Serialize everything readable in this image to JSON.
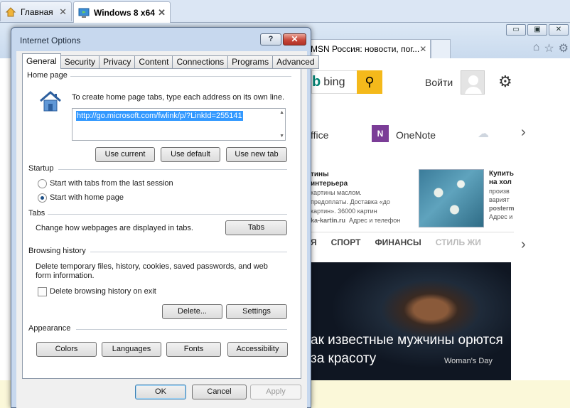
{
  "vbox_tabs": [
    {
      "label": "Главная",
      "close": "✕"
    },
    {
      "label": "Windows 8 x64",
      "close": "✕"
    }
  ],
  "ie": {
    "window_buttons": [
      "▭",
      "▣",
      "✕"
    ],
    "tab_title": "MSN Россия: новости, пог...",
    "tab_close": "✕",
    "toolbar_icons": [
      "⌂",
      "☆",
      "⚙"
    ],
    "page": {
      "search_brand": "bing",
      "search_go": "⚲",
      "login": "Войти",
      "gear": "⚙",
      "apps": {
        "office": "ffice",
        "onenote_icon": "N",
        "onenote": "OneNote"
      },
      "chevron": "›",
      "news_left": {
        "title_1": "тины",
        "title_2": "интерьера",
        "body_1": "картины маслом.",
        "body_2": "предоплаты. Доставка «до",
        "body_3": "картин». 36000 картин",
        "source": "ka-kartin.ru",
        "phone": "Адрес и телефон"
      },
      "news_right": {
        "title_1": "Купить",
        "title_2": "на хол",
        "body_1": "произв",
        "body_2": "варият",
        "source": "posterm",
        "phone": "Адрес и"
      },
      "categories": [
        "Я",
        "СПОРТ",
        "ФИНАНСЫ",
        "СТИЛЬ ЖИ"
      ],
      "hero_title": "ак известные мужчины орются за красоту",
      "hero_source": "Woman's Day",
      "hero_next": "›"
    }
  },
  "dialog": {
    "title": "Internet Options",
    "help": "?",
    "close": "✕",
    "tabs": [
      "General",
      "Security",
      "Privacy",
      "Content",
      "Connections",
      "Programs",
      "Advanced"
    ],
    "home_page": {
      "heading": "Home page",
      "description": "To create home page tabs, type each address on its own line.",
      "url": "http://go.microsoft.com/fwlink/p/?LinkId=255141",
      "use_current": "Use current",
      "use_default": "Use default",
      "use_new_tab": "Use new tab"
    },
    "startup": {
      "heading": "Startup",
      "option_last_session": "Start with tabs from the last session",
      "option_home_page": "Start with home page",
      "selected": "option_home_page"
    },
    "tabs_section": {
      "heading": "Tabs",
      "description": "Change how webpages are displayed in tabs.",
      "button": "Tabs"
    },
    "browsing_history": {
      "heading": "Browsing history",
      "description_1": "Delete temporary files, history, cookies, saved passwords, and web",
      "description_2": "form information.",
      "delete_on_exit": "Delete browsing history on exit",
      "delete_on_exit_checked": false,
      "delete": "Delete...",
      "settings": "Settings"
    },
    "appearance": {
      "heading": "Appearance",
      "colors": "Colors",
      "languages": "Languages",
      "fonts": "Fonts",
      "accessibility": "Accessibility"
    },
    "footer": {
      "ok": "OK",
      "cancel": "Cancel",
      "apply": "Apply"
    }
  }
}
